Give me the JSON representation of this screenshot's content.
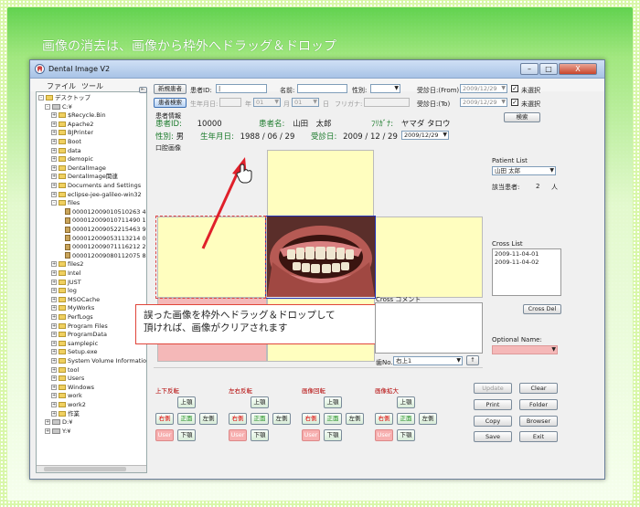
{
  "caption": "画像の消去は、画像から枠外へドラッグ＆ドロップ",
  "window": {
    "title": "Dental Image V2",
    "min": "–",
    "max": "□",
    "close": "X"
  },
  "menu": [
    "ファイル",
    "ツール"
  ],
  "tree": [
    {
      "indent": 0,
      "pm": "⊟",
      "icon": "folder",
      "label": "デスクトップ"
    },
    {
      "indent": 1,
      "pm": "⊟",
      "icon": "drive",
      "label": "C:¥"
    },
    {
      "indent": 2,
      "pm": "⊞",
      "icon": "folder",
      "label": "$Recycle.Bin"
    },
    {
      "indent": 2,
      "pm": "⊞",
      "icon": "folder",
      "label": "Apache2"
    },
    {
      "indent": 2,
      "pm": "⊞",
      "icon": "folder",
      "label": "BJPrinter"
    },
    {
      "indent": 2,
      "pm": "⊞",
      "icon": "folder",
      "label": "Boot"
    },
    {
      "indent": 2,
      "pm": "⊞",
      "icon": "folder",
      "label": "data"
    },
    {
      "indent": 2,
      "pm": "⊞",
      "icon": "folder",
      "label": "demopic"
    },
    {
      "indent": 2,
      "pm": "⊞",
      "icon": "folder",
      "label": "DentalImage"
    },
    {
      "indent": 2,
      "pm": "⊞",
      "icon": "folder",
      "label": "DentalImage関連"
    },
    {
      "indent": 2,
      "pm": "⊞",
      "icon": "folder",
      "label": "Documents and Settings"
    },
    {
      "indent": 2,
      "pm": "⊞",
      "icon": "folder",
      "label": "eclipse-jee-galileo-win32"
    },
    {
      "indent": 2,
      "pm": "⊟",
      "icon": "folder",
      "label": "files"
    },
    {
      "indent": 3,
      "pm": "",
      "icon": "file",
      "label": "000012009010510263 4.t"
    },
    {
      "indent": 3,
      "pm": "",
      "icon": "file",
      "label": "000012009010711490 1.J"
    },
    {
      "indent": 3,
      "pm": "",
      "icon": "file",
      "label": "000012009052215463 9.J"
    },
    {
      "indent": 3,
      "pm": "",
      "icon": "file",
      "label": "000012009053113214 0.J"
    },
    {
      "indent": 3,
      "pm": "",
      "icon": "file",
      "label": "000012009071116212 2.J"
    },
    {
      "indent": 3,
      "pm": "",
      "icon": "file",
      "label": "000012009080112075 8.J"
    },
    {
      "indent": 2,
      "pm": "⊞",
      "icon": "folder",
      "label": "files2"
    },
    {
      "indent": 2,
      "pm": "⊞",
      "icon": "folder",
      "label": "Intel"
    },
    {
      "indent": 2,
      "pm": "⊞",
      "icon": "folder",
      "label": "JUST"
    },
    {
      "indent": 2,
      "pm": "⊞",
      "icon": "folder",
      "label": "log"
    },
    {
      "indent": 2,
      "pm": "⊞",
      "icon": "folder",
      "label": "MSOCache"
    },
    {
      "indent": 2,
      "pm": "⊞",
      "icon": "folder",
      "label": "MyWorks"
    },
    {
      "indent": 2,
      "pm": "⊞",
      "icon": "folder",
      "label": "PerfLogs"
    },
    {
      "indent": 2,
      "pm": "⊞",
      "icon": "folder",
      "label": "Program Files"
    },
    {
      "indent": 2,
      "pm": "⊞",
      "icon": "folder",
      "label": "ProgramData"
    },
    {
      "indent": 2,
      "pm": "⊞",
      "icon": "folder",
      "label": "samplepic"
    },
    {
      "indent": 2,
      "pm": "⊞",
      "icon": "folder",
      "label": "Setup.exe"
    },
    {
      "indent": 2,
      "pm": "⊞",
      "icon": "folder",
      "label": "System Volume Information"
    },
    {
      "indent": 2,
      "pm": "⊞",
      "icon": "folder",
      "label": "tool"
    },
    {
      "indent": 2,
      "pm": "⊞",
      "icon": "folder",
      "label": "Users"
    },
    {
      "indent": 2,
      "pm": "⊞",
      "icon": "folder",
      "label": "Windows"
    },
    {
      "indent": 2,
      "pm": "⊞",
      "icon": "folder",
      "label": "work"
    },
    {
      "indent": 2,
      "pm": "⊞",
      "icon": "folder",
      "label": "work2"
    },
    {
      "indent": 2,
      "pm": "⊞",
      "icon": "folder",
      "label": "作業"
    },
    {
      "indent": 1,
      "pm": "⊞",
      "icon": "drive",
      "label": "D:¥"
    },
    {
      "indent": 1,
      "pm": "⊞",
      "icon": "drive",
      "label": "Y:¥"
    }
  ],
  "search": {
    "new_patient": "新規患者",
    "patient_id_label": "患者ID:",
    "patient_id_value": "|",
    "name_label": "名前:",
    "gender_label": "性別:",
    "visit_from_label": "受診日:(From)",
    "visit_from_value": "2009/12/29",
    "unselected1": "未選択",
    "patient_search": "患者検索",
    "birth_label": "生年月日:",
    "year_label": "年",
    "month_value": "01",
    "month_label": "月",
    "day_value": "01",
    "day_label": "日",
    "furigana_label": "フリガナ:",
    "visit_to_label": "受診日:(To)",
    "visit_to_value": "2009/12/29",
    "unselected2": "未選択",
    "search_btn": "検索"
  },
  "patient": {
    "section_label": "患者情報",
    "id_label": "患者ID:",
    "id_value": "10000",
    "name_label": "患者名:",
    "name_value": "山田　太郎",
    "kana_label": "ﾌﾘｶﾞﾅ:",
    "kana_value": "ヤマダ タロウ",
    "gender_label": "性別:",
    "gender_value": "男",
    "birth_label": "生年月日:",
    "birth_value": "1988 / 06 / 29",
    "visit_label": "受診日:",
    "visit_value": "2009 / 12 / 29",
    "visit_select": "2009/12/29"
  },
  "oral_label": "口腔画像",
  "callout": [
    "誤った画像を枠外へドラッグ＆ドロップして",
    "頂ければ、画像がクリアされます"
  ],
  "patient_list": {
    "label": "Patient List",
    "selected": "山田 太郎",
    "count_label": "該当患者:",
    "count_value": "2",
    "count_unit": "人"
  },
  "cross_list": {
    "label": "Cross List",
    "items": [
      "2009-11-04-01",
      "2009-11-04-02"
    ],
    "del_btn": "Cross Del"
  },
  "cross_comment_label": "Cross コメント",
  "optional_name_label": "Optional Name:",
  "tooth": {
    "label": "歯No.",
    "value": "右上1",
    "up_btn": "↑"
  },
  "groups": [
    {
      "title": "上下反転",
      "top": "上顎",
      "left": "右側",
      "mid": "正面",
      "right": "左側",
      "user": "User",
      "bottom": "下顎"
    },
    {
      "title": "左右反転",
      "top": "上顎",
      "left": "右側",
      "mid": "正面",
      "right": "左側",
      "user": "User",
      "bottom": "下顎"
    },
    {
      "title": "画像回転",
      "top": "上顎",
      "left": "右側",
      "mid": "正面",
      "right": "左側",
      "user": "User",
      "bottom": "下顎"
    },
    {
      "title": "画像拡大",
      "top": "上顎",
      "left": "右側",
      "mid": "正面",
      "right": "左側",
      "user": "User",
      "bottom": "下顎"
    }
  ],
  "actions": {
    "update": "Update",
    "clear": "Clear",
    "print": "Print",
    "folder": "Folder",
    "copy": "Copy",
    "browser": "Browser",
    "save": "Save",
    "exit": "Exit"
  },
  "colors": {
    "accent_green": "#1a7a2a",
    "cell_yellow": "#fffebf",
    "cell_pink": "#f5b8b8",
    "callout_border": "#e0453a"
  }
}
